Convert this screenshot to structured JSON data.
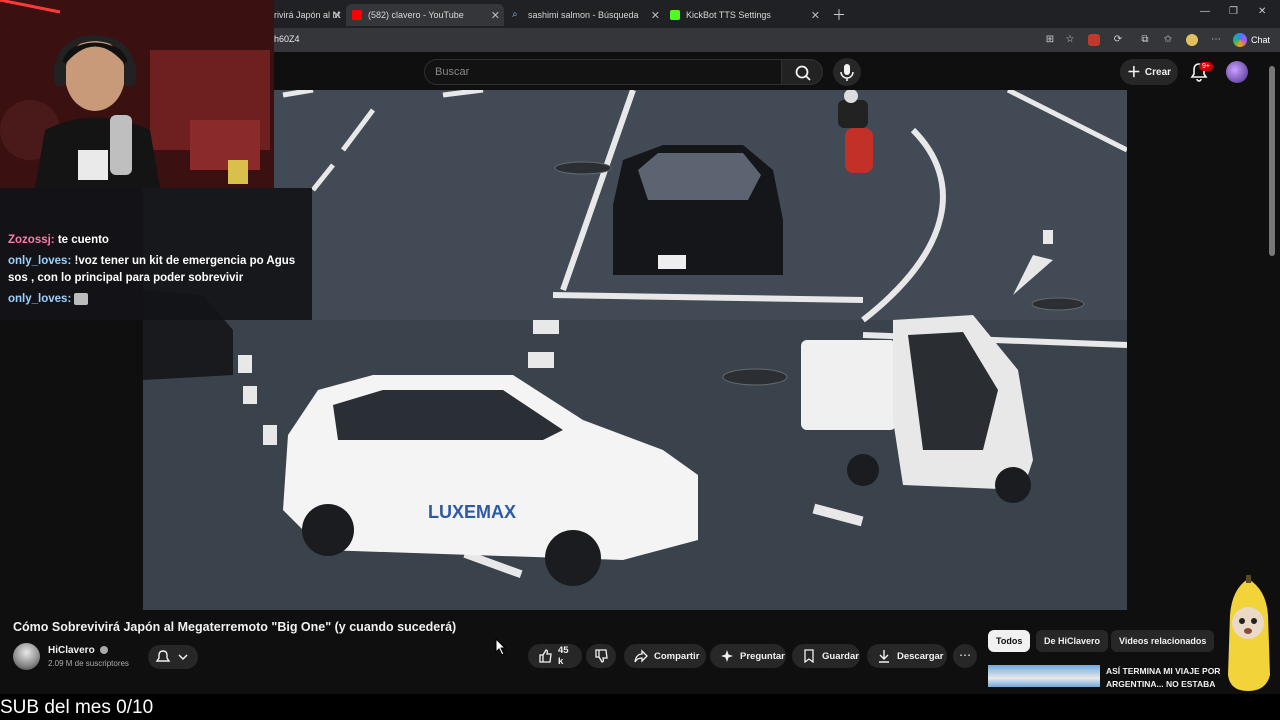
{
  "browser": {
    "tabs": [
      {
        "label": "rivirá Japón al M",
        "active": false
      },
      {
        "label": "(582) clavero - YouTube",
        "active": true
      },
      {
        "label": "sashimi salmon - Búsqueda",
        "active": false
      },
      {
        "label": "KickBot TTS Settings",
        "active": false
      }
    ],
    "url": "h60Z4",
    "chat_label": "Chat"
  },
  "header": {
    "search_placeholder": "Buscar",
    "create_label": "Crear",
    "notif_badge": "9+"
  },
  "stream_chat": [
    {
      "user": "Zozossj:",
      "text": "te cuento"
    },
    {
      "user": "only_loves:",
      "text": "!voz tener un kit de emergencia po Agus sos , con lo principal para poder sobrevivir"
    },
    {
      "user": "only_loves:",
      "text": ""
    }
  ],
  "video": {
    "title": "Cómo Sobrevivirá Japón al Megaterremoto \"Big One\" (y cuando sucederá)",
    "channel": "HiClavero",
    "subscribers": "2.09 M de suscriptores",
    "likes": "45 k",
    "actions": {
      "share": "Compartir",
      "ask": "Preguntar",
      "save": "Guardar",
      "download": "Descargar"
    }
  },
  "related": {
    "chips": [
      "Todos",
      "De HiClavero",
      "Videos relacionados"
    ],
    "first_title": "ASÍ TERMINA MI VIAJE POR ARGENTINA... NO ESTABA"
  },
  "overlay": {
    "sub_goal": "SUB del mes 0/10"
  },
  "colors": {
    "user_zozossj": "#ff7aa8",
    "user_onlyloves": "#9ad2ff",
    "badge_red": "#cc0000",
    "youtube_red": "#ff0000"
  }
}
